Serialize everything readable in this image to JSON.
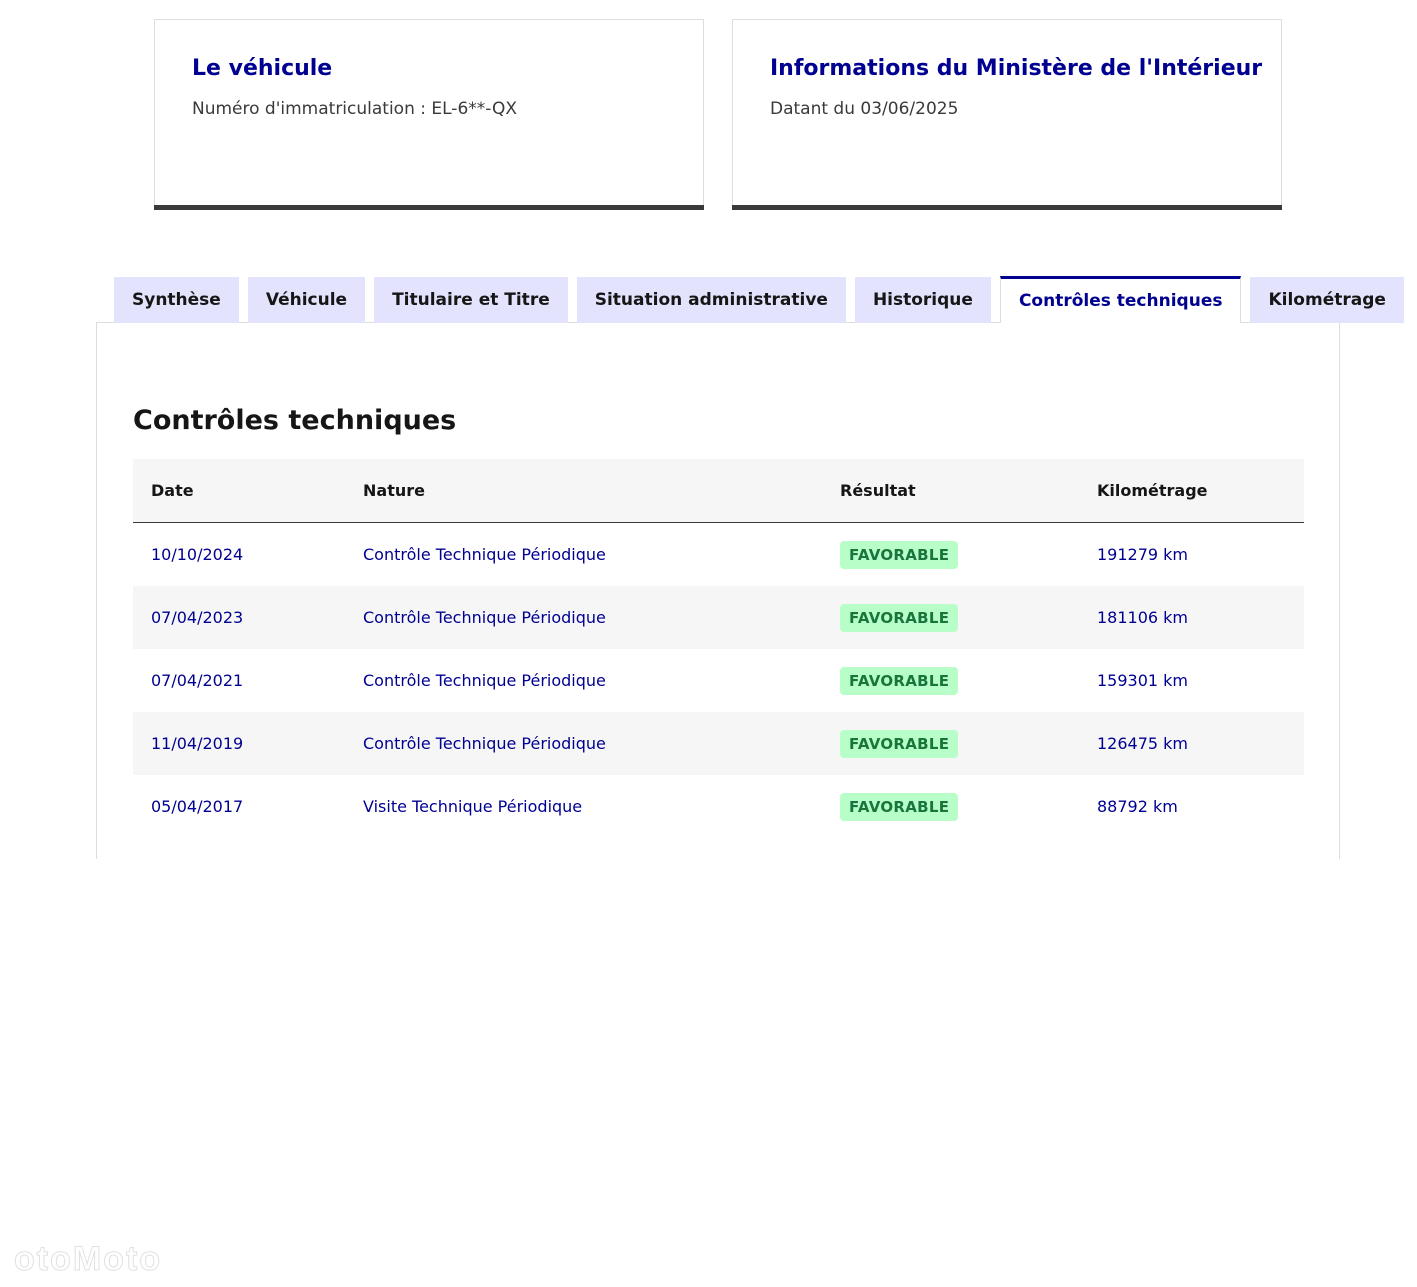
{
  "cards": [
    {
      "title": "Le véhicule",
      "description": "Numéro d'immatriculation : EL-6**-QX"
    },
    {
      "title": "Informations du Ministère de l'Intérieur",
      "description": "Datant du 03/06/2025"
    }
  ],
  "tabs": [
    {
      "label": "Synthèse",
      "active": false
    },
    {
      "label": "Véhicule",
      "active": false
    },
    {
      "label": "Titulaire et Titre",
      "active": false
    },
    {
      "label": "Situation administrative",
      "active": false
    },
    {
      "label": "Historique",
      "active": false
    },
    {
      "label": "Contrôles techniques",
      "active": true
    },
    {
      "label": "Kilométrage",
      "active": false
    }
  ],
  "panel": {
    "title": "Contrôles techniques",
    "table": {
      "headers": {
        "date": "Date",
        "nature": "Nature",
        "result": "Résultat",
        "mileage": "Kilométrage"
      },
      "rows": [
        {
          "date": "10/10/2024",
          "nature": "Contrôle Technique Périodique",
          "result": "FAVORABLE",
          "mileage": "191279 km"
        },
        {
          "date": "07/04/2023",
          "nature": "Contrôle Technique Périodique",
          "result": "FAVORABLE",
          "mileage": "181106 km"
        },
        {
          "date": "07/04/2021",
          "nature": "Contrôle Technique Périodique",
          "result": "FAVORABLE",
          "mileage": "159301 km"
        },
        {
          "date": "11/04/2019",
          "nature": "Contrôle Technique Périodique",
          "result": "FAVORABLE",
          "mileage": "126475 km"
        },
        {
          "date": "05/04/2017",
          "nature": "Visite Technique Périodique",
          "result": "FAVORABLE",
          "mileage": "88792 km"
        }
      ]
    }
  },
  "watermark": "otoMoto",
  "colors": {
    "primary_blue": "#000091",
    "tab_inactive_bg": "#e3e3fd",
    "badge_bg": "#b8fec9",
    "badge_text": "#18753c",
    "row_stripe": "#f6f6f6",
    "card_border_bottom": "#3a3a3a"
  }
}
